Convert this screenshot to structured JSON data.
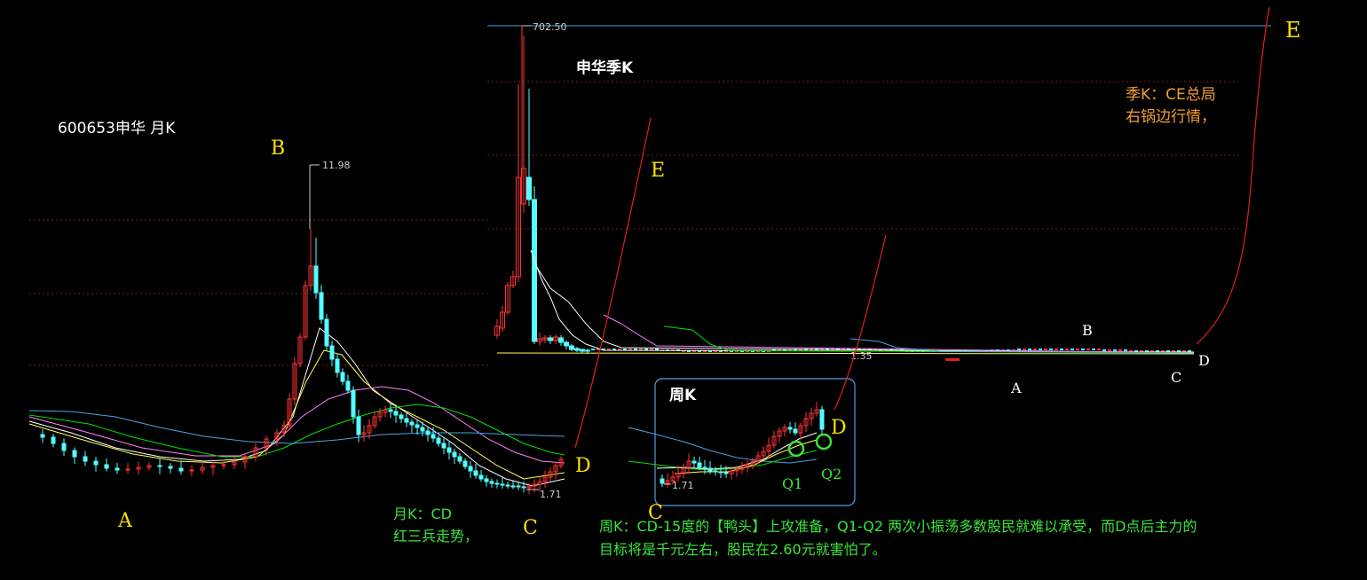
{
  "colors": {
    "background": "#000000",
    "candle_up": "#ff3232",
    "candle_down": "#54ffff",
    "ma5": "#ffffff",
    "ma10": "#ffff54",
    "ma20": "#ff80ff",
    "ma30": "#00e000",
    "ma60": "#4aa3df",
    "annotation_yellow": "#ffe000",
    "annotation_green": "#39e539",
    "annotation_orange": "#f0a030",
    "trend_red": "#e02020",
    "label_white": "#ffffff"
  },
  "monthly": {
    "title": "600653申华 月K",
    "high_label": "11.98",
    "low_label": "1.71",
    "points": {
      "a": "A",
      "b": "B",
      "c": "C",
      "d": "D"
    },
    "note_lines": [
      "月K：CD",
      "红三兵走势，"
    ]
  },
  "quarterly": {
    "title": "申华季K",
    "high_label": "702.50",
    "low_label": "1.35",
    "points": {
      "a": "A",
      "b": "B",
      "c": "C",
      "d": "D",
      "e": "E"
    },
    "note_lines": [
      "季K：CE总局",
      "右锅边行情，"
    ]
  },
  "monthly_e": "E",
  "weekly": {
    "title": "周K",
    "low_label": "1.71",
    "points": {
      "c": "C",
      "d": "D"
    },
    "q1": "Q1",
    "q2": "Q2",
    "note_lines": [
      "周K：CD-15度的【鸭头】上攻准备，Q1-Q2 两次小振荡多数股民就难以承受，而D点后主力的",
      "目标将是千元左右，股民在2.60元就害怕了。"
    ]
  },
  "chart_data": [
    {
      "type": "candlestick",
      "title": "600653申华 月K",
      "ylim": [
        1.71,
        11.98
      ],
      "annotations": [
        "11.98",
        "1.71"
      ],
      "swing_points": [
        {
          "label": "A",
          "price": 2.2
        },
        {
          "label": "B",
          "price": 11.98
        },
        {
          "label": "C",
          "price": 1.71
        },
        {
          "label": "D",
          "price": 2.6
        }
      ]
    },
    {
      "type": "candlestick",
      "title": "申华季K",
      "ylim": [
        1.35,
        702.5
      ],
      "annotations": [
        "702.50",
        "1.35"
      ],
      "swing_points": [
        {
          "label": "A",
          "price": 1.35
        },
        {
          "label": "B",
          "price": 11.98
        },
        {
          "label": "C",
          "price": 1.71
        },
        {
          "label": "D",
          "price": 2.6
        },
        {
          "label": "E",
          "price": 702.5
        }
      ]
    },
    {
      "type": "candlestick",
      "title": "周K",
      "annotations": [
        "1.71"
      ],
      "swing_points": [
        {
          "label": "C",
          "price": 1.71
        },
        {
          "label": "D",
          "price": 2.6
        }
      ]
    }
  ]
}
